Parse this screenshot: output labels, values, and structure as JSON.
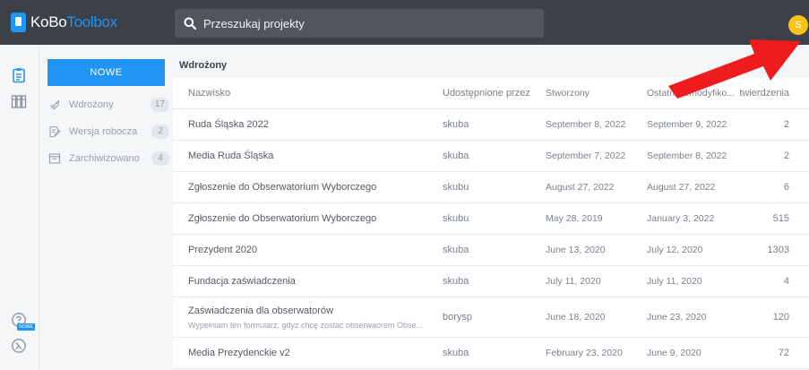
{
  "topbar": {
    "logo_kobo": "KoBo",
    "logo_toolbox": "Toolbox",
    "search_placeholder": "Przeszukaj projekty",
    "account_initial": "S"
  },
  "rail": {
    "new_badge": "NOWE"
  },
  "sidebar": {
    "new_button": "NOWE",
    "items": [
      {
        "label": "Wdrożony",
        "count": "17",
        "icon": "rocket-icon"
      },
      {
        "label": "Wersja robocza",
        "count": "2",
        "icon": "draft-icon"
      },
      {
        "label": "Zarchiwizowano",
        "count": "4",
        "icon": "archive-icon"
      }
    ]
  },
  "main": {
    "section_title": "Wdrożony",
    "headers": {
      "name": "Nazwisko",
      "owner": "Udostępnione przez",
      "created": "Stworzony",
      "modified": "Ostatnio zmodyfiko...",
      "submissions": "Zatwierdzenia"
    },
    "rows": [
      {
        "name": "Ruda Śląska 2022",
        "owner": "skuba",
        "created": "September 8, 2022",
        "modified": "September 9, 2022",
        "submissions": "2"
      },
      {
        "name": "Media Ruda Śląska",
        "owner": "skuba",
        "created": "September 7, 2022",
        "modified": "September 8, 2022",
        "submissions": "2"
      },
      {
        "name": "Zgłoszenie do Obserwatorium Wyborczego",
        "owner": "skubu",
        "created": "August 27, 2022",
        "modified": "August 27, 2022",
        "submissions": "6"
      },
      {
        "name": "Zgłoszenie do Obserwatorium Wyborczego",
        "owner": "skubu",
        "created": "May 28, 2019",
        "modified": "January 3, 2022",
        "submissions": "515"
      },
      {
        "name": "Prezydent 2020",
        "owner": "skuba",
        "created": "June 13, 2020",
        "modified": "July 12, 2020",
        "submissions": "1303"
      },
      {
        "name": "Fundacja zaświadczenia",
        "owner": "skuba",
        "created": "July 11, 2020",
        "modified": "July 11, 2020",
        "submissions": "4"
      },
      {
        "name": "Zaświadczenia dla obserwatorów",
        "description": "Wypełniam ten formularz, gdyż chcę zostać obserwaorem Obse...",
        "owner": "borysp",
        "created": "June 18, 2020",
        "modified": "June 23, 2020",
        "submissions": "120"
      },
      {
        "name": "Media Prezydenckie v2",
        "owner": "skuba",
        "created": "February 23, 2020",
        "modified": "June 9, 2020",
        "submissions": "72"
      }
    ]
  },
  "colors": {
    "topbar": "#3c4049",
    "accent": "#2095f3",
    "account": "#f7c317",
    "annotation_arrow": "#ee1c1c"
  }
}
